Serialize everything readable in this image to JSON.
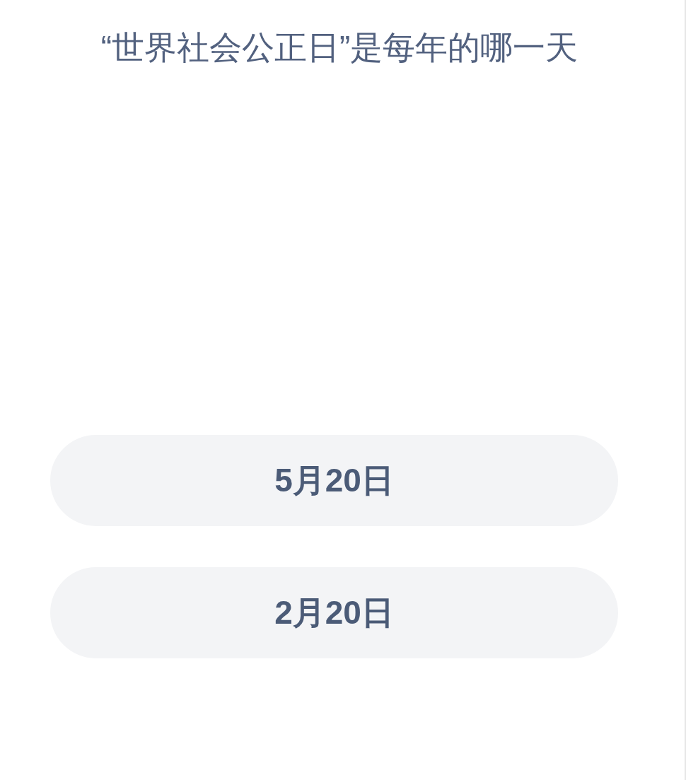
{
  "question": "“世界社会公正日”是每年的哪一天",
  "options": [
    {
      "label": "5月20日"
    },
    {
      "label": "2月20日"
    }
  ]
}
